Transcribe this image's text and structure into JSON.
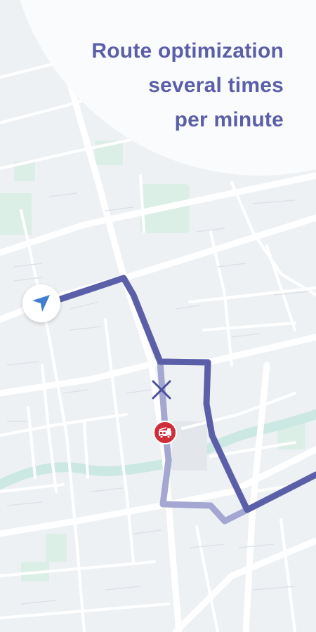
{
  "headline": {
    "line1": "Route optimization",
    "line2": "several times",
    "line3": "per minute"
  },
  "colors": {
    "background": "#eef1f4",
    "roads": "#ffffff",
    "parks": "#dcefe6",
    "water": "#cbe8e3",
    "route_active": "#5a5fa8",
    "route_inactive": "#a3a7d1",
    "incident": "#d12c3a",
    "headline_text": "#5a5fa8"
  },
  "icons": {
    "current_location": "navigation-arrow-icon",
    "road_closed": "close-x-icon",
    "incident": "fire-truck-icon"
  }
}
